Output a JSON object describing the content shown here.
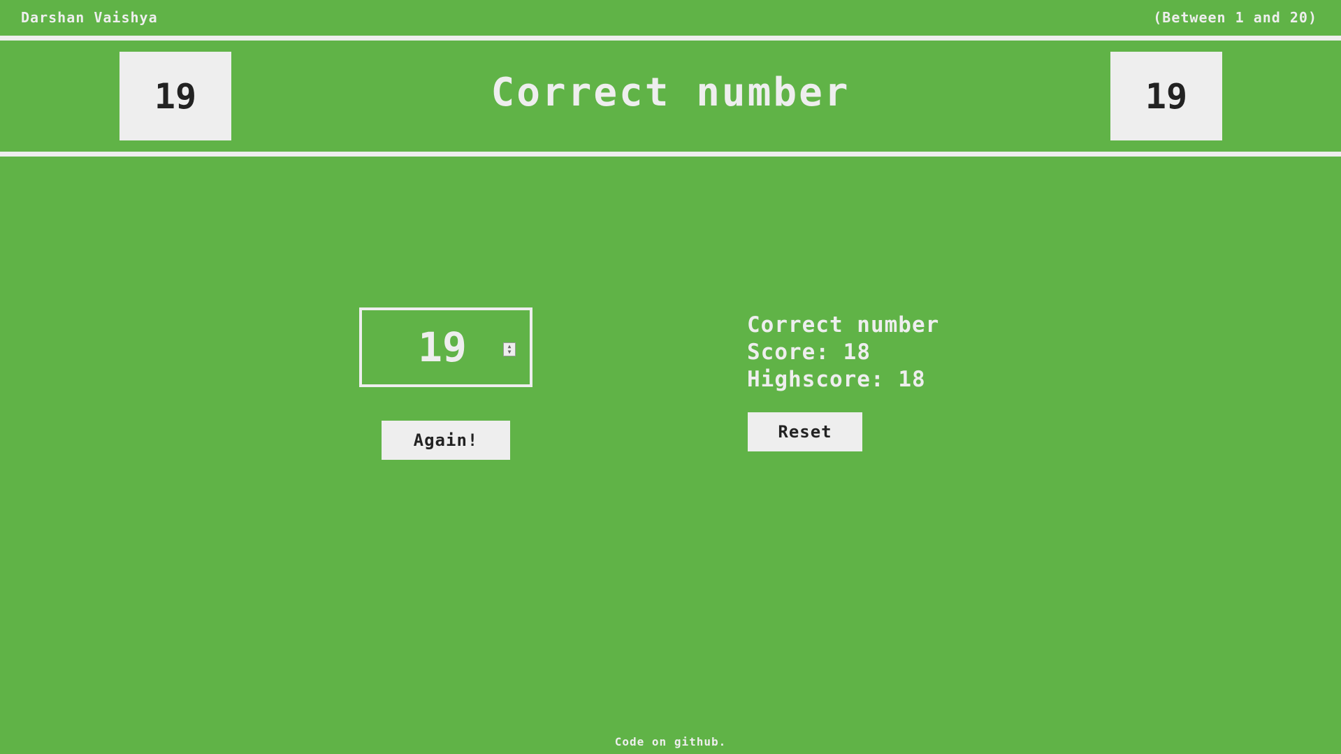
{
  "header": {
    "author": "Darshan Vaishya",
    "range_hint": "(Between 1 and 20)",
    "title": "Correct number",
    "left_number": "19",
    "right_number": "19"
  },
  "guess": {
    "value": "19"
  },
  "buttons": {
    "again_label": "Again!",
    "reset_label": "Reset"
  },
  "stats": {
    "message": "Correct number",
    "score_label": "Score:",
    "score_value": "18",
    "highscore_label": "Highscore:",
    "highscore_value": "18"
  },
  "footer": {
    "text": "Code on github."
  },
  "colors": {
    "background": "#60b347",
    "foreground": "#eeeeee",
    "dark_text": "#222222"
  }
}
